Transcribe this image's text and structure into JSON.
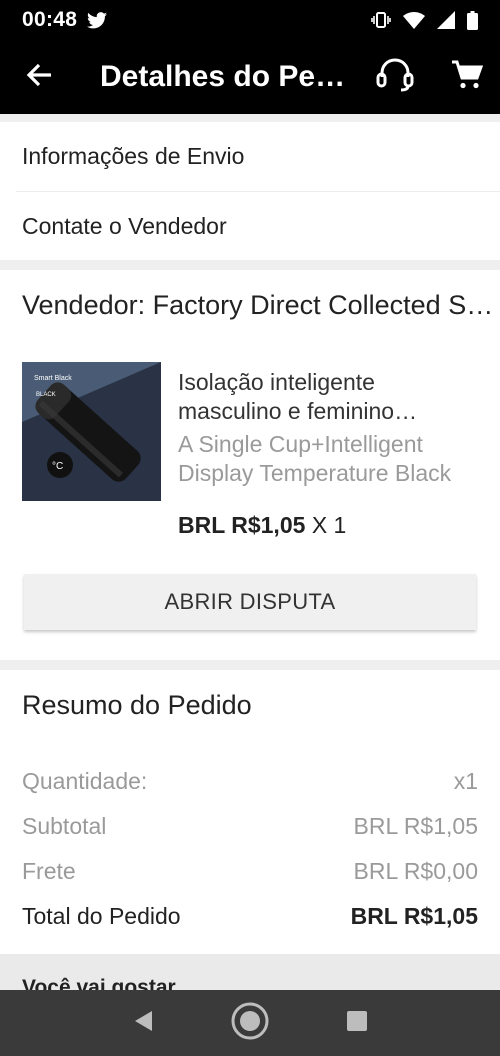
{
  "status_bar": {
    "time": "00:48"
  },
  "app_bar": {
    "title": "Detalhes do Pedido"
  },
  "links": {
    "shipping_info": "Informações de Envio",
    "contact_seller": "Contate o Vendedor"
  },
  "seller": {
    "name": "Vendedor: Factory Direct Collected Store",
    "product": {
      "thumb_text_1": "Smart Black",
      "thumb_text_2": "BLACK",
      "title": "Isolação inteligente masculino e feminino estudante",
      "variant": "A Single Cup+Intelligent Display Temperature Black",
      "price": "BRL R$1,05",
      "quantity": "X 1"
    },
    "dispute_button": "ABRIR DISPUTA"
  },
  "summary": {
    "title": "Resumo do Pedido",
    "rows": [
      {
        "label": "Quantidade:",
        "value": "x1"
      },
      {
        "label": "Subtotal",
        "value": "BRL R$1,05"
      },
      {
        "label": "Frete",
        "value": "BRL R$0,00"
      },
      {
        "label": "Total do Pedido",
        "value": "BRL R$1,05"
      }
    ]
  },
  "recommendations": {
    "title": "Você vai gostar"
  },
  "icons": {
    "back": "arrow-left-icon",
    "support": "headset-icon",
    "cart": "shopping-cart-icon",
    "nav_back": "triangle-back-icon",
    "nav_home": "circle-home-icon",
    "nav_recents": "square-recents-icon"
  },
  "colors": {
    "app_bar": "#000000",
    "background": "#efefef",
    "muted_text": "#9a9a9a",
    "nav_bar": "#3a3a3a"
  }
}
